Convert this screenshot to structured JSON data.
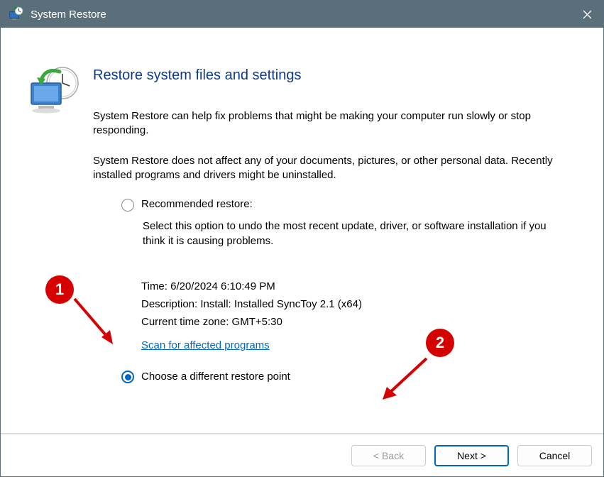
{
  "titlebar": {
    "title": "System Restore"
  },
  "main": {
    "heading": "Restore system files and settings",
    "para1": "System Restore can help fix problems that might be making your computer run slowly or stop responding.",
    "para2": "System Restore does not affect any of your documents, pictures, or other personal data. Recently installed programs and drivers might be uninstalled.",
    "radio_recommended": "Recommended restore:",
    "radio_recommended_desc": "Select this option to undo the most recent update, driver, or software installation if you think it is causing problems.",
    "detail_time": "Time: 6/20/2024 6:10:49 PM",
    "detail_desc": "Description: Install: Installed SyncToy 2.1 (x64)",
    "detail_tz": "Current time zone: GMT+5:30",
    "scan_link": "Scan for affected programs",
    "radio_choose": "Choose a different restore point"
  },
  "buttons": {
    "back": "< Back",
    "next": "Next >",
    "cancel": "Cancel"
  },
  "annotations": {
    "a1": "1",
    "a2": "2"
  }
}
